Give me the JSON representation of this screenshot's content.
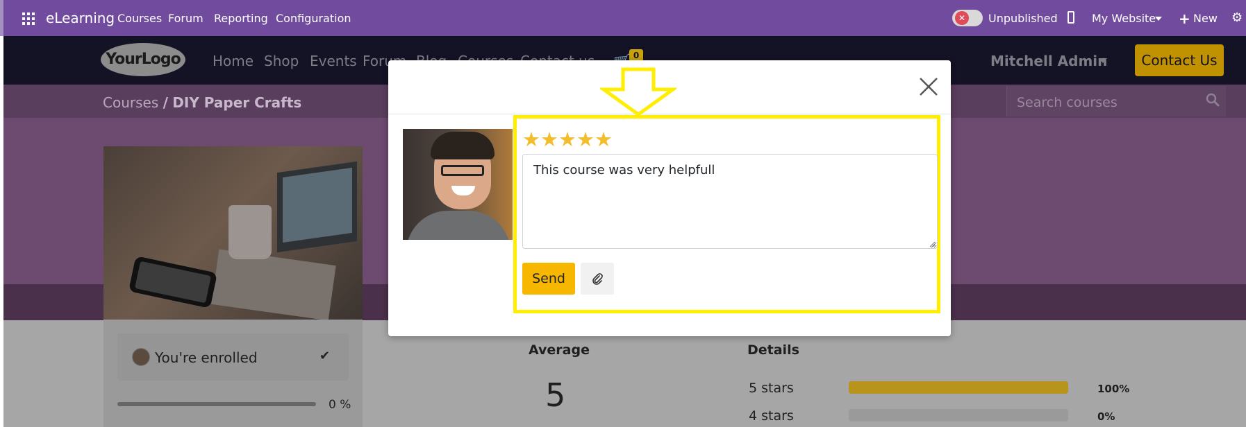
{
  "topbar": {
    "app_name": "eLearning",
    "menu": [
      "Courses",
      "Forum",
      "Reporting",
      "Configuration"
    ],
    "publish_status": "Unpublished",
    "website_selector": "My Website",
    "new_label": "New"
  },
  "site": {
    "logo_text": "YourLogo",
    "nav": [
      "Home",
      "Shop",
      "Events",
      "Forum",
      "Blog",
      "Courses",
      "Contact us"
    ],
    "cart_count": "0",
    "user_name": "Mitchell Admin",
    "contact_button": "Contact Us",
    "breadcrumb": {
      "root": "Courses",
      "separator": "/",
      "current": "DIY Paper Crafts"
    },
    "search_placeholder": "Search courses"
  },
  "course_panel": {
    "enrolled_text": "You're enrolled",
    "progress_label": "0 %",
    "progress_fraction": 0
  },
  "ratings": {
    "average_label": "Average",
    "average_value": "5",
    "details_label": "Details",
    "rows": [
      {
        "label": "5 stars",
        "percent_label": "100%",
        "fraction": 1.0
      },
      {
        "label": "4 stars",
        "percent_label": "0%",
        "fraction": 0.0
      }
    ]
  },
  "review_modal": {
    "rating": 5,
    "review_text": "This course was very helpfull",
    "send_label": "Send"
  },
  "colors": {
    "odoo_purple": "#714b9e",
    "accent_yellow": "#f7b600",
    "highlight": "#ffee00",
    "star": "#f3bd2d"
  },
  "icons": [
    "apps-grid-icon",
    "toggle-x-icon",
    "mobile-icon",
    "caret-down-icon",
    "plus-icon",
    "gear-icon",
    "cart-icon",
    "search-icon",
    "check-icon",
    "close-icon",
    "star-icon",
    "paperclip-icon",
    "down-arrow-icon"
  ]
}
